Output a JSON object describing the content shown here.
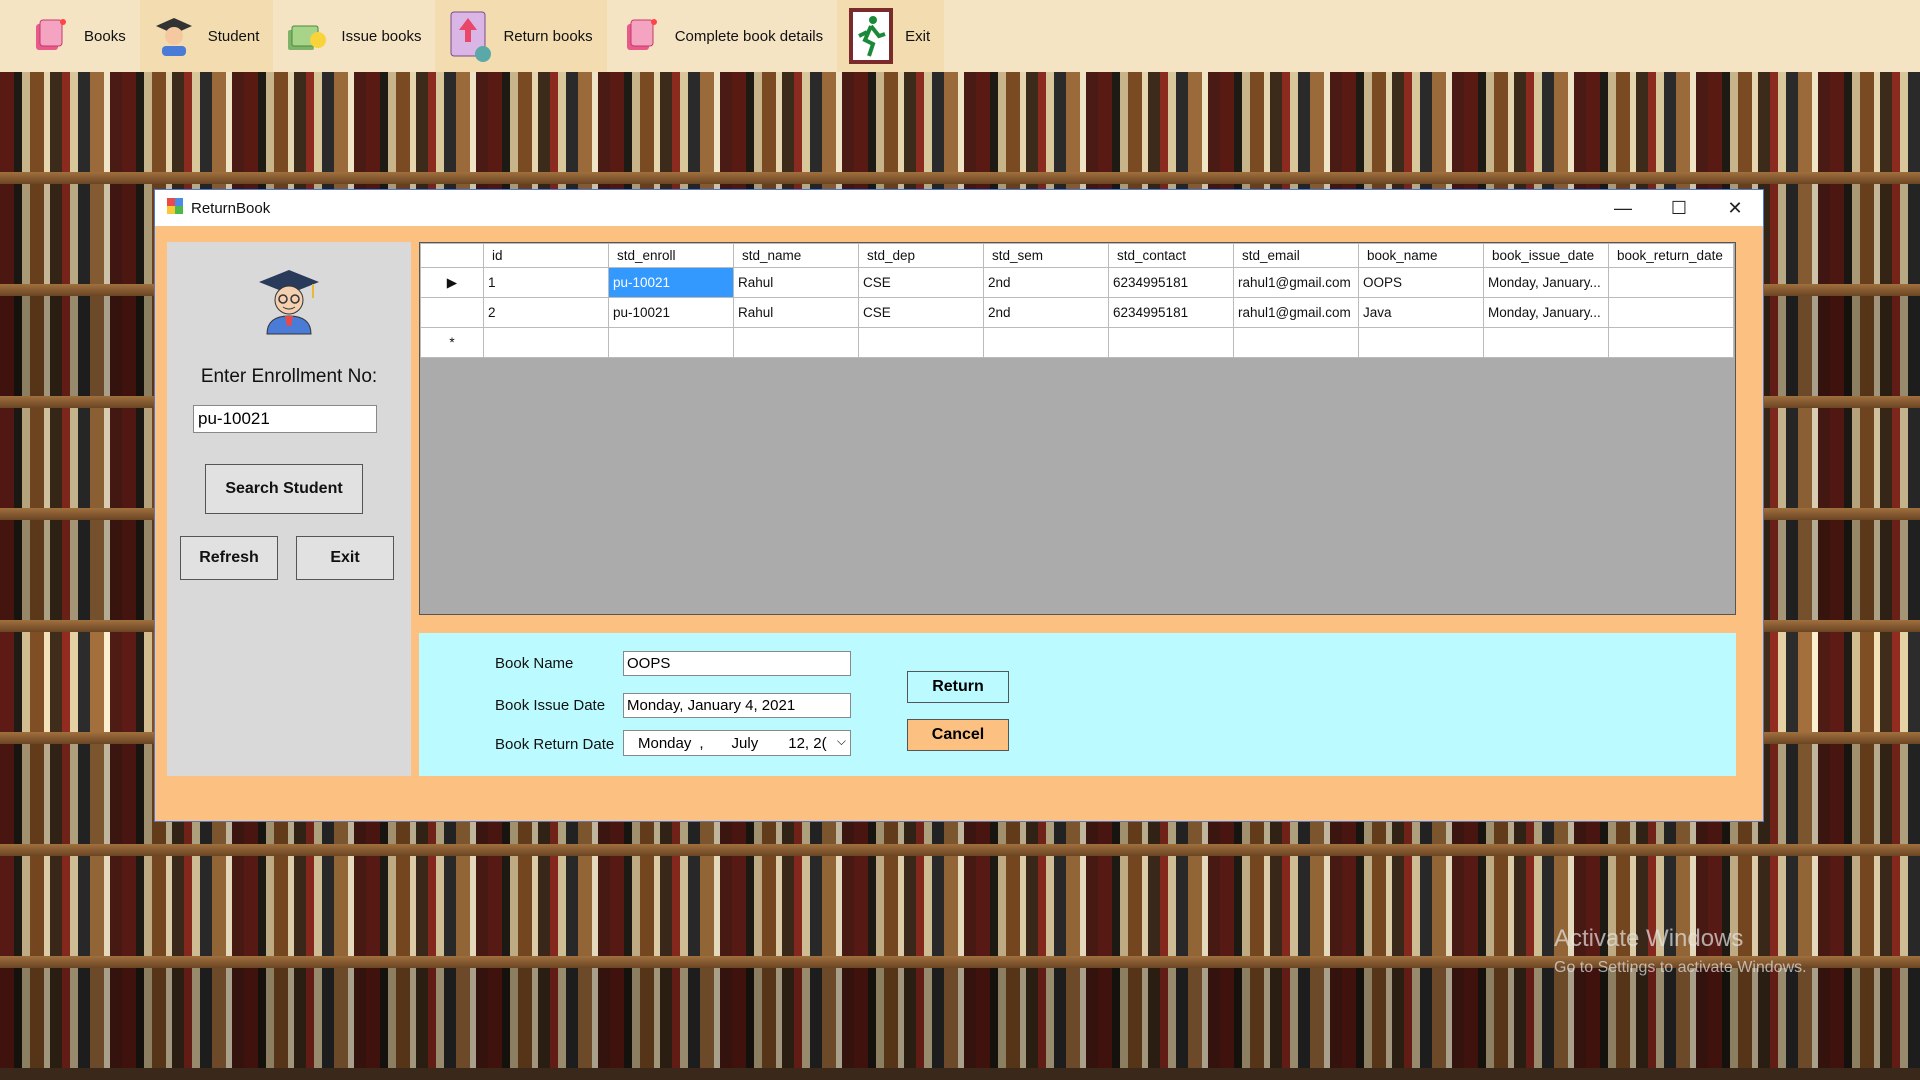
{
  "toolbar": {
    "items": [
      {
        "label": "Books",
        "icon": "books-icon"
      },
      {
        "label": "Student",
        "icon": "student-icon"
      },
      {
        "label": "Issue books",
        "icon": "issue-books-icon"
      },
      {
        "label": "Return books",
        "icon": "return-books-icon"
      },
      {
        "label": "Complete book details",
        "icon": "book-details-icon"
      },
      {
        "label": "Exit",
        "icon": "exit-icon"
      }
    ]
  },
  "window": {
    "title": "ReturnBook",
    "controls": {
      "minimize": "—",
      "maximize": "☐",
      "close": "✕"
    }
  },
  "left_panel": {
    "enroll_label": "Enter Enrollment No:",
    "enroll_value": "pu-10021",
    "search_label": "Search Student",
    "refresh_label": "Refresh",
    "exit_label": "Exit"
  },
  "grid": {
    "columns": [
      "id",
      "std_enroll",
      "std_name",
      "std_dep",
      "std_sem",
      "std_contact",
      "std_email",
      "book_name",
      "book_issue_date",
      "book_return_date"
    ],
    "rows": [
      [
        "1",
        "pu-10021",
        "Rahul",
        "CSE",
        "2nd",
        "6234995181",
        "rahul1@gmail.com",
        "OOPS",
        "Monday, January...",
        ""
      ],
      [
        "2",
        "pu-10021",
        "Rahul",
        "CSE",
        "2nd",
        "6234995181",
        "rahul1@gmail.com",
        "Java",
        "Monday, January...",
        ""
      ]
    ],
    "current_row_marker": "▶",
    "new_row_marker": "*"
  },
  "details": {
    "book_name_label": "Book Name",
    "book_name_value": "OOPS",
    "issue_date_label": "Book Issue Date",
    "issue_date_value": "Monday, January 4, 2021",
    "return_date_label": "Book Return Date",
    "return_date": {
      "weekday": "Monday",
      "sep": ",",
      "month": "July",
      "day_year": "12, 2("
    },
    "return_label": "Return",
    "cancel_label": "Cancel"
  },
  "watermark": {
    "line1": "Activate Windows",
    "line2": "Go to Settings to activate Windows."
  },
  "colors": {
    "toolbar_bg": "#f5e4c3",
    "window_bg": "#fcc080",
    "detail_bg": "#bbfbff",
    "selection": "#3399ff"
  }
}
